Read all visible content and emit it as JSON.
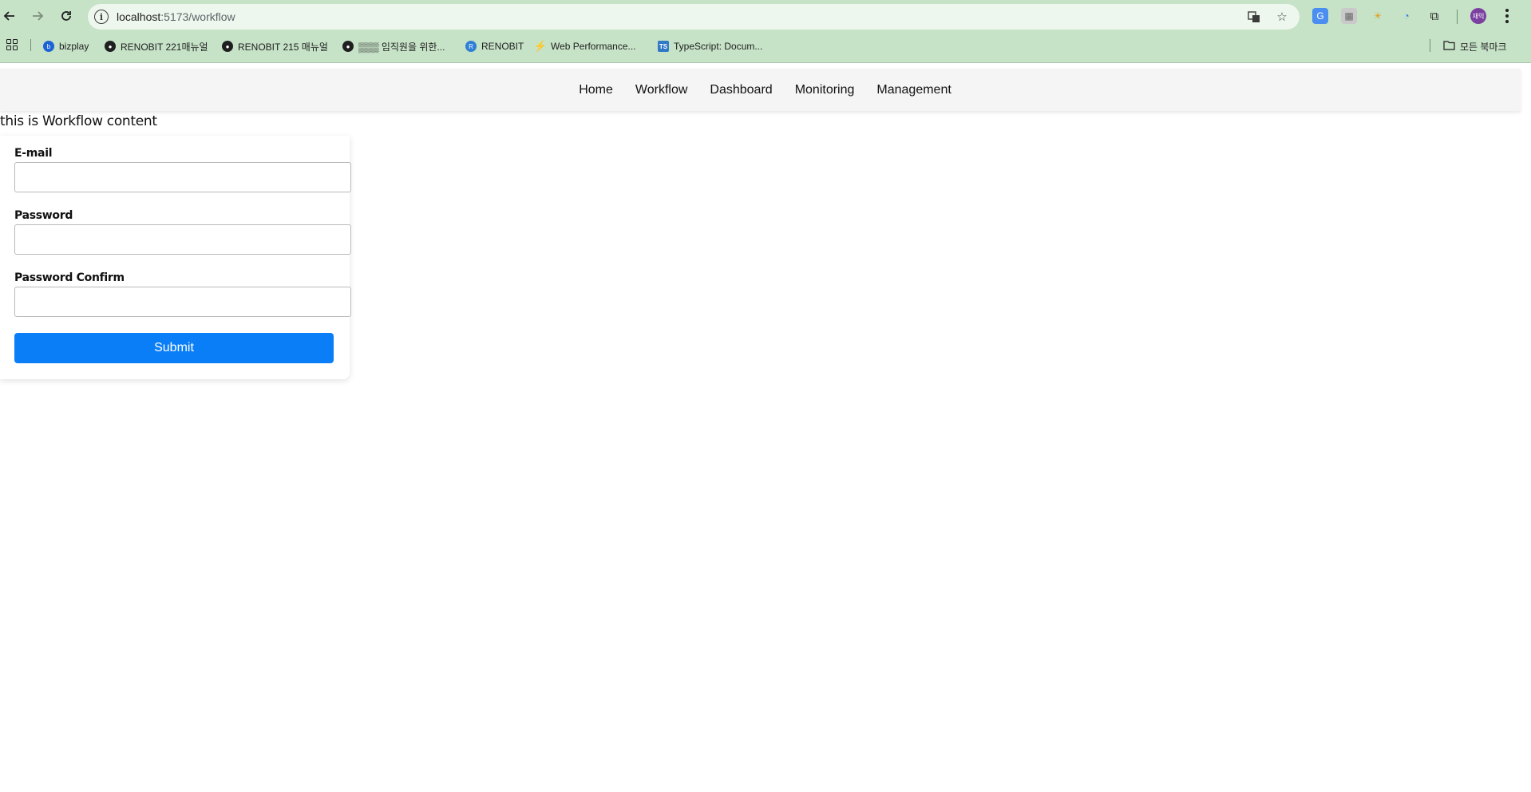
{
  "browser": {
    "url_host": "localhost",
    "url_path": ":5173/workflow",
    "profile_initials": "재익"
  },
  "bookmarks": [
    {
      "label": "bizplay",
      "icon": "bizplay-icon",
      "color": "#1e63d6"
    },
    {
      "label": "RENOBIT 221매뉴얼",
      "icon": "globe-icon",
      "color": "#1f1f1f"
    },
    {
      "label": "RENOBIT 215 매뉴얼",
      "icon": "globe-icon",
      "color": "#1f1f1f"
    },
    {
      "label": "▒▒▒ 임직원을 위한...",
      "icon": "globe-icon",
      "color": "#1f1f1f"
    },
    {
      "label": "RENOBIT",
      "icon": "renobit-icon",
      "color": "#2f7fd6"
    },
    {
      "label": "Web Performance...",
      "icon": "lightning-icon",
      "color": "#f2a733"
    },
    {
      "label": "TypeScript: Docum...",
      "icon": "typescript-icon",
      "color": "#3178c6"
    }
  ],
  "all_bookmarks_label": "모든 북마크",
  "nav": {
    "items": [
      "Home",
      "Workflow",
      "Dashboard",
      "Monitoring",
      "Management"
    ]
  },
  "content_text": "this is Workflow content",
  "form": {
    "email_label": "E-mail",
    "email_value": "",
    "password_label": "Password",
    "password_value": "",
    "password_confirm_label": "Password Confirm",
    "password_confirm_value": "",
    "submit_label": "Submit"
  },
  "colors": {
    "chrome": "#c6e2c7",
    "submit": "#0a7ef6",
    "navbar": "#f5f5f5"
  }
}
